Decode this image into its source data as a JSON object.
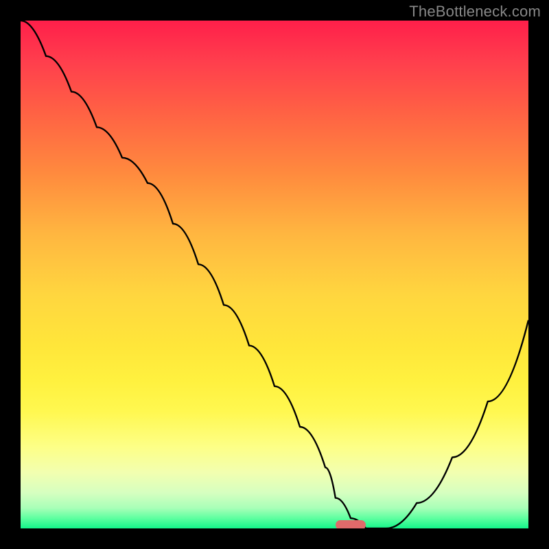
{
  "watermark": "TheBottleneck.com",
  "chart_data": {
    "type": "line",
    "title": "",
    "xlabel": "",
    "ylabel": "",
    "x": [
      0,
      5,
      10,
      15,
      20,
      25,
      30,
      35,
      40,
      45,
      50,
      55,
      60,
      62,
      65,
      68,
      72,
      78,
      85,
      92,
      100
    ],
    "values": [
      100,
      93,
      86,
      79,
      73,
      68,
      60,
      52,
      44,
      36,
      28,
      20,
      12,
      6,
      2,
      0,
      0,
      5,
      14,
      25,
      41
    ],
    "xlim": [
      0,
      100
    ],
    "ylim": [
      0,
      100
    ],
    "annotations": [
      {
        "type": "marker",
        "x": 65,
        "y": 0,
        "color": "#e06a6a"
      }
    ],
    "background_gradient": {
      "top": "#ff1f4a",
      "mid": "#ffd63f",
      "bottom": "#14f58a"
    }
  }
}
